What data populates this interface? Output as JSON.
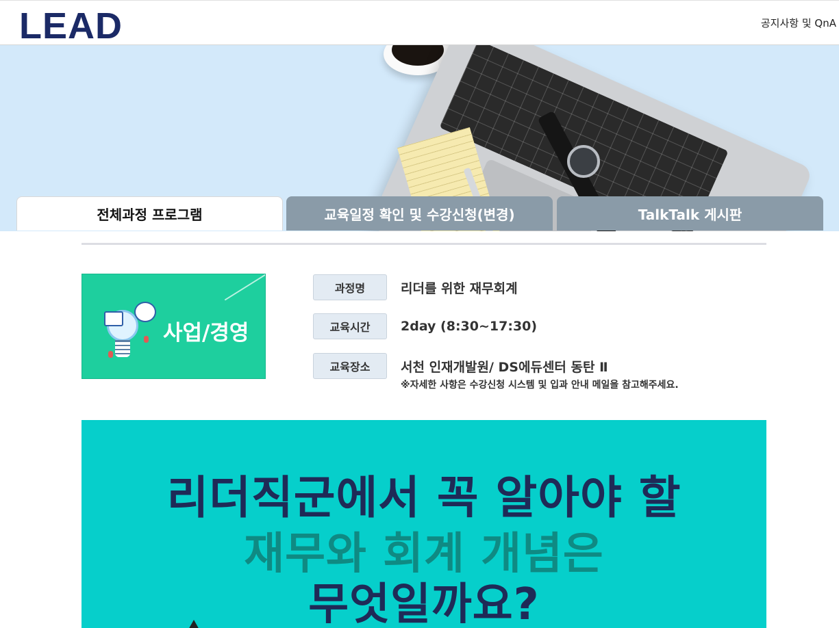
{
  "header": {
    "logo_text": "LEAD",
    "notice_link": "공지사항 및 QnA"
  },
  "tabs": [
    {
      "label": "전체과정 프로그램",
      "active": true
    },
    {
      "label": "교육일정 확인 및 수강신청(변경)",
      "active": false
    },
    {
      "label": "TalkTalk 게시판",
      "active": false
    }
  ],
  "category": {
    "label": "사업/경영",
    "icon": "lightbulb-chat-icon",
    "color": "#1ecf9e"
  },
  "course_info": {
    "rows": [
      {
        "key": "과정명",
        "value": "리더를 위한 재무회계"
      },
      {
        "key": "교육시간",
        "value": "2day (8:30~17:30)"
      },
      {
        "key": "교육장소",
        "value": "서천 인재개발원/ DS에듀센터 동탄 Ⅱ"
      }
    ],
    "note": "※자세한 사항은 수강신청 시스템 및 입과 안내 메일을 참고해주세요."
  },
  "banner": {
    "line1": "리더직군에서 꼭 알아야 할",
    "line2": "재무와 회계 개념은",
    "line3": "무엇일까요?",
    "background": "#06cfcb"
  }
}
